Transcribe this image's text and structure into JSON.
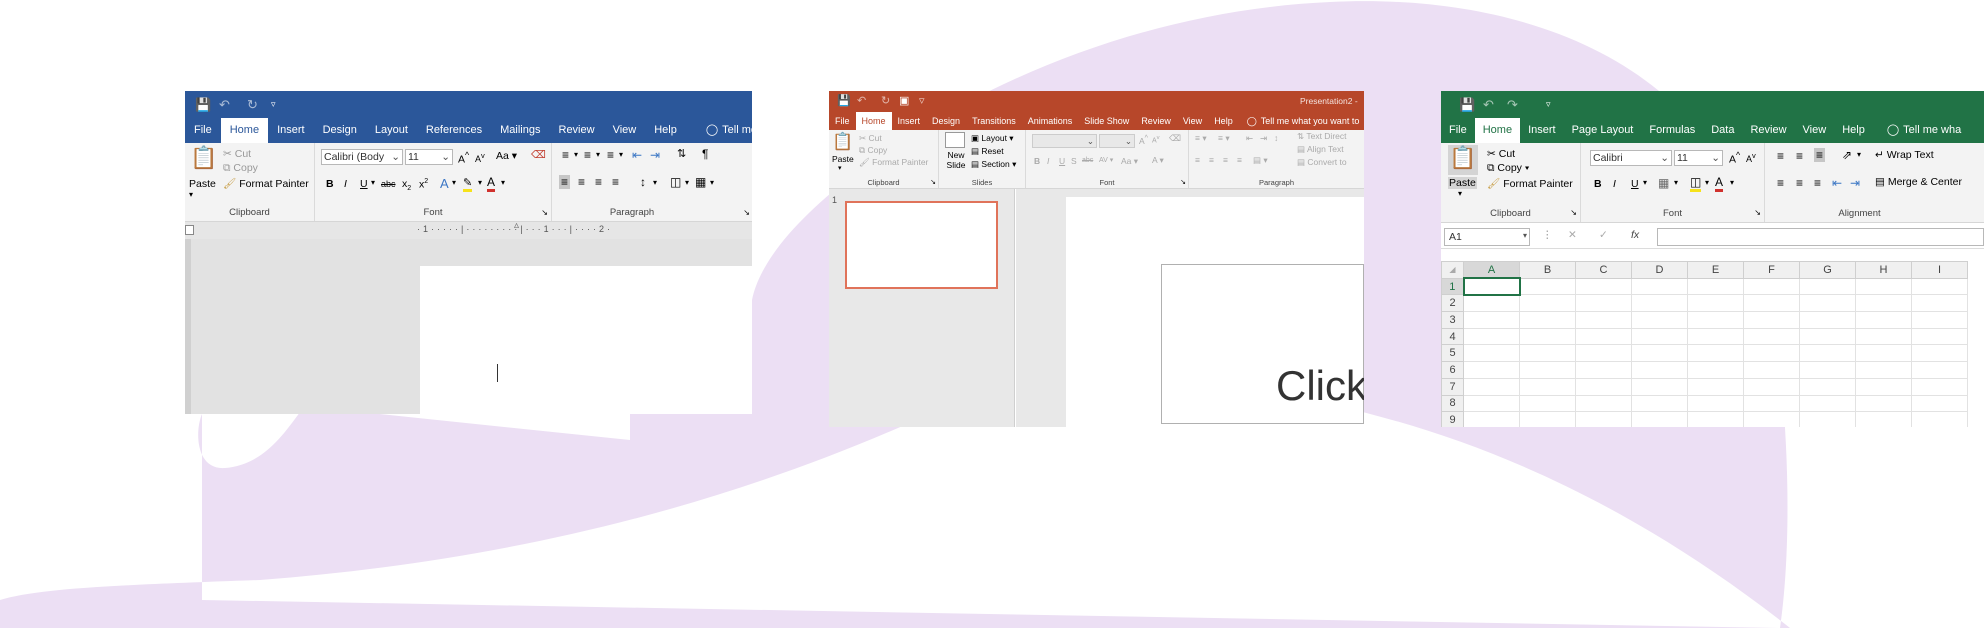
{
  "colors": {
    "word_brand": "#2b579a",
    "powerpoint_brand": "#b7472a",
    "excel_brand": "#217346",
    "background_blob": "#ecdff4"
  },
  "word": {
    "tabs": [
      "File",
      "Home",
      "Insert",
      "Design",
      "Layout",
      "References",
      "Mailings",
      "Review",
      "View",
      "Help"
    ],
    "tell_me": "Tell me w",
    "clipboard": {
      "paste": "Paste",
      "cut": "Cut",
      "copy": "Copy",
      "format_painter": "Format Painter",
      "label": "Clipboard"
    },
    "font": {
      "name": "Calibri (Body",
      "size": "11",
      "label": "Font",
      "case": "Aa"
    },
    "paragraph": {
      "label": "Paragraph"
    }
  },
  "powerpoint": {
    "title": "Presentation2 - ",
    "tabs": [
      "File",
      "Home",
      "Insert",
      "Design",
      "Transitions",
      "Animations",
      "Slide Show",
      "Review",
      "View",
      "Help"
    ],
    "tell_me": "Tell me what you want to",
    "clipboard": {
      "paste": "Paste",
      "cut": "Cut",
      "copy": "Copy",
      "format_painter": "Format Painter",
      "label": "Clipboard"
    },
    "slides": {
      "new_slide": "New Slide",
      "layout": "Layout",
      "reset": "Reset",
      "section": "Section",
      "label": "Slides"
    },
    "font": {
      "label": "Font"
    },
    "paragraph": {
      "label": "Paragraph",
      "text_direction": "Text Direct",
      "align_text": "Align Text",
      "convert": "Convert to"
    },
    "slide_number": "1",
    "slide_text": "Click"
  },
  "excel": {
    "tabs": [
      "File",
      "Home",
      "Insert",
      "Page Layout",
      "Formulas",
      "Data",
      "Review",
      "View",
      "Help"
    ],
    "tell_me": "Tell me wha",
    "clipboard": {
      "paste": "Paste",
      "cut": "Cut",
      "copy": "Copy",
      "format_painter": "Format Painter",
      "label": "Clipboard"
    },
    "font": {
      "name": "Calibri",
      "size": "11",
      "label": "Font"
    },
    "alignment": {
      "wrap_text": "Wrap Text",
      "merge_center": "Merge & Center",
      "label": "Alignment"
    },
    "name_box": "A1",
    "fx": "fx",
    "columns": [
      "A",
      "B",
      "C",
      "D",
      "E",
      "F",
      "G",
      "H",
      "I"
    ],
    "rows": [
      "1",
      "2",
      "3",
      "4",
      "5",
      "6",
      "7",
      "8",
      "9"
    ]
  }
}
